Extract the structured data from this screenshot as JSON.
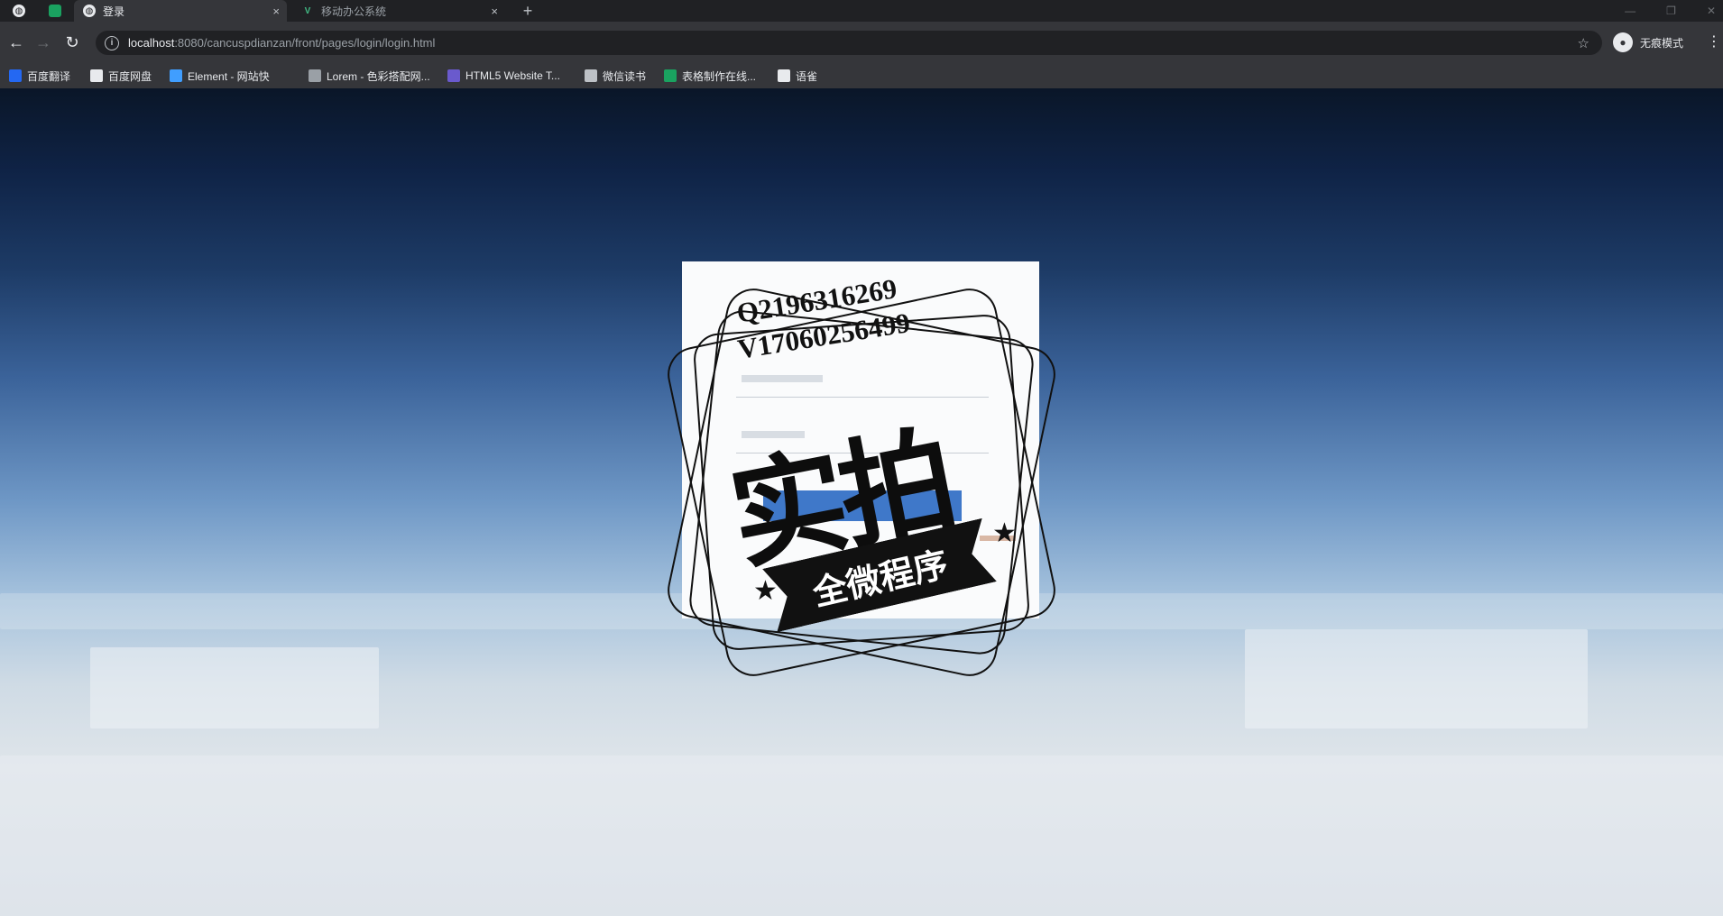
{
  "browser": {
    "tabs": [
      {
        "title": "",
        "favicon": "pinned-green-tab"
      },
      {
        "title": "登录",
        "close": "×",
        "active": true
      },
      {
        "title": "移动办公系统",
        "close": "×"
      }
    ],
    "new_tab": "+",
    "address": {
      "host": "localhost",
      "rest": ":8080/cancuspdianzan/front/pages/login/login.html"
    },
    "incognito_label": "无痕模式",
    "bookmarks": [
      "百度翻译",
      "百度网盘",
      "Element - 网站快",
      "Lorem - 色彩搭配网...",
      "HTML5 Website T...",
      "微信读书",
      "表格制作在线...",
      "语雀"
    ]
  },
  "watermark": {
    "qq": "Q2196316269",
    "wechat": "V17060256499",
    "main": "实拍",
    "ribbon": "全微程序"
  },
  "page": {
    "corner_line1": "",
    "corner_line2": ""
  },
  "colors": {
    "button": "#3f78c9",
    "tab_bg": "#202124",
    "toolbar_bg": "#35363a"
  }
}
